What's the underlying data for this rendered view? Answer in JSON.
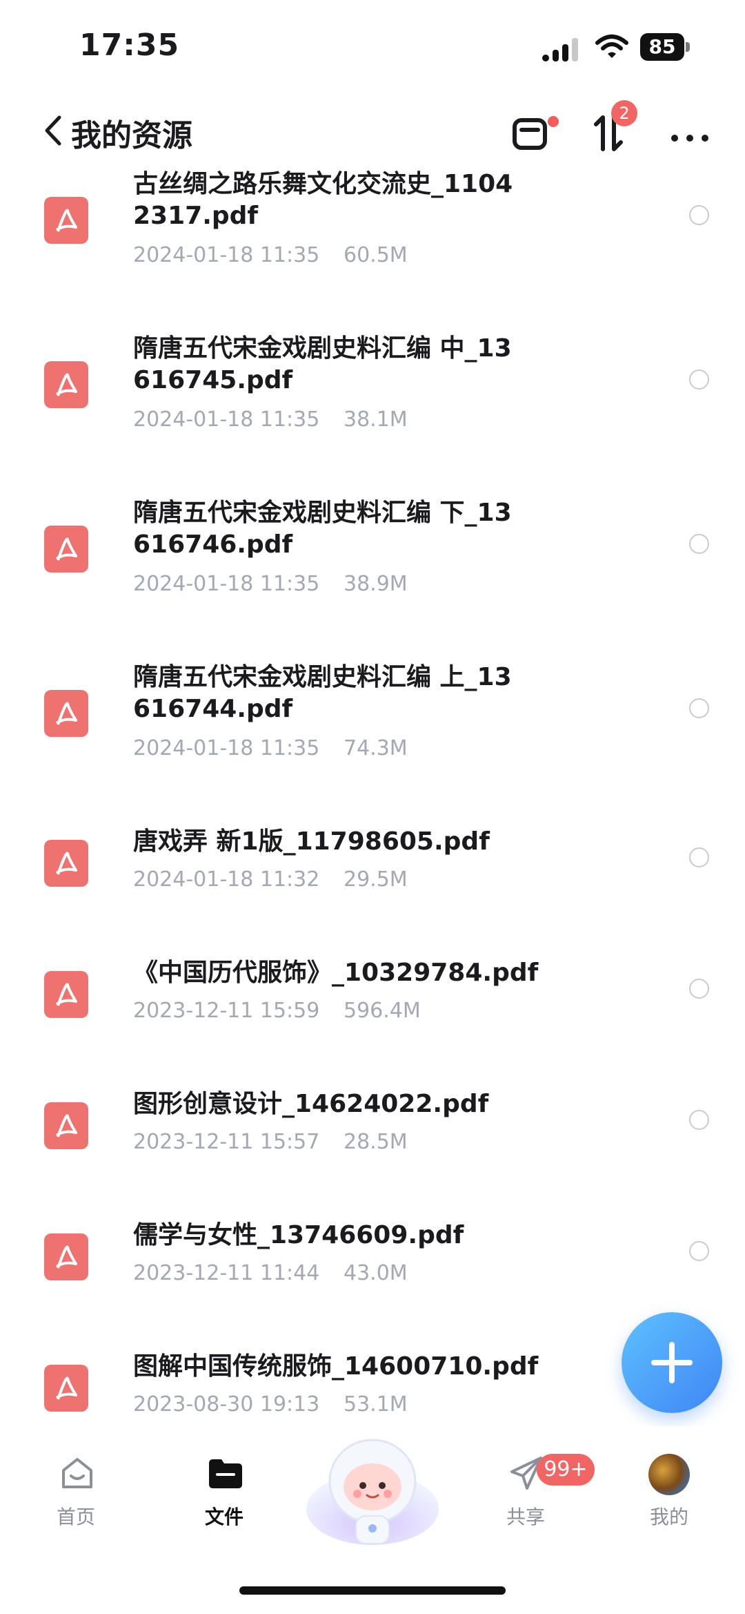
{
  "status_bar": {
    "time": "17:35",
    "battery": "85"
  },
  "header": {
    "title": "我的资源",
    "transfer_count": "2"
  },
  "files": [
    {
      "name": "古丝绸之路乐舞文化交流史_11042317.pdf",
      "date": "2024-01-18 11:35",
      "size": "60.5M"
    },
    {
      "name": "隋唐五代宋金戏剧史料汇编  中_13616745.pdf",
      "date": "2024-01-18 11:35",
      "size": "38.1M"
    },
    {
      "name": "隋唐五代宋金戏剧史料汇编  下_13616746.pdf",
      "date": "2024-01-18 11:35",
      "size": "38.9M"
    },
    {
      "name": "隋唐五代宋金戏剧史料汇编  上_13616744.pdf",
      "date": "2024-01-18 11:35",
      "size": "74.3M"
    },
    {
      "name": "唐戏弄  新1版_11798605.pdf",
      "date": "2024-01-18 11:32",
      "size": "29.5M"
    },
    {
      "name": "《中国历代服饰》_10329784.pdf",
      "date": "2023-12-11 15:59",
      "size": "596.4M"
    },
    {
      "name": "图形创意设计_14624022.pdf",
      "date": "2023-12-11 15:57",
      "size": "28.5M"
    },
    {
      "name": "儒学与女性_13746609.pdf",
      "date": "2023-12-11 11:44",
      "size": "43.0M"
    },
    {
      "name": "图解中国传统服饰_14600710.pdf",
      "date": "2023-08-30 19:13",
      "size": "53.1M"
    }
  ],
  "nav": {
    "home": "首页",
    "files": "文件",
    "share": "共享",
    "share_badge": "99+",
    "mine": "我的"
  },
  "colors": {
    "accent": "#3f86f5",
    "pdf": "#ee7370",
    "badge": "#f16565"
  }
}
